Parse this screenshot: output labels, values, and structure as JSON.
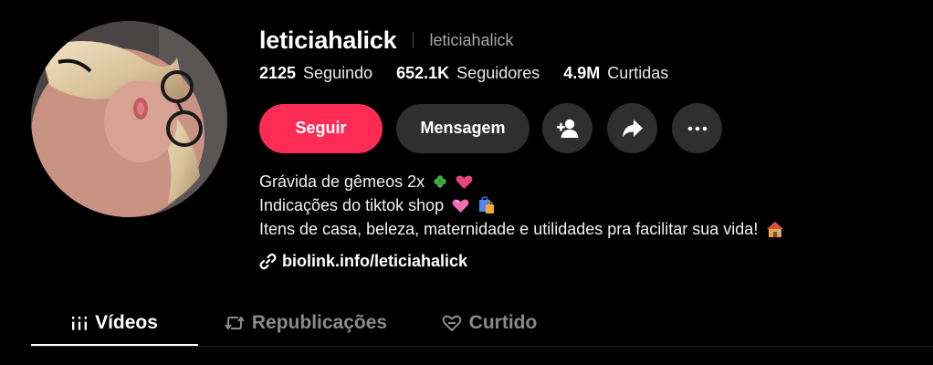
{
  "profile": {
    "username": "leticiahalick",
    "nickname": "leticiahalick",
    "avatar_alt": "profile photo"
  },
  "stats": [
    {
      "value": "2125",
      "label": "Seguindo"
    },
    {
      "value": "652.1K",
      "label": "Seguidores"
    },
    {
      "value": "4.9M",
      "label": "Curtidas"
    }
  ],
  "actions": {
    "follow_label": "Seguir",
    "message_label": "Mensagem",
    "add_friend_icon": "add-user-icon",
    "share_icon": "share-icon",
    "more_icon": "more-icon"
  },
  "bio": {
    "line1": "Grávida de gêmeos 2x",
    "line2": "Indicações do tiktok shop",
    "line3": "Itens de casa, beleza, maternidade e utilidades pra facilitar sua vida!"
  },
  "link": {
    "text": "biolink.info/leticiahalick",
    "icon": "link-icon"
  },
  "tabs": [
    {
      "label": "Vídeos",
      "icon": "grid-icon",
      "active": true
    },
    {
      "label": "Republicações",
      "icon": "repost-icon",
      "active": false
    },
    {
      "label": "Curtido",
      "icon": "heart-icon",
      "active": false
    }
  ],
  "colors": {
    "background": "#000000",
    "accent": "#fe2c55",
    "button_secondary": "#2f2f2f",
    "muted_text": "#a6a6a6"
  }
}
